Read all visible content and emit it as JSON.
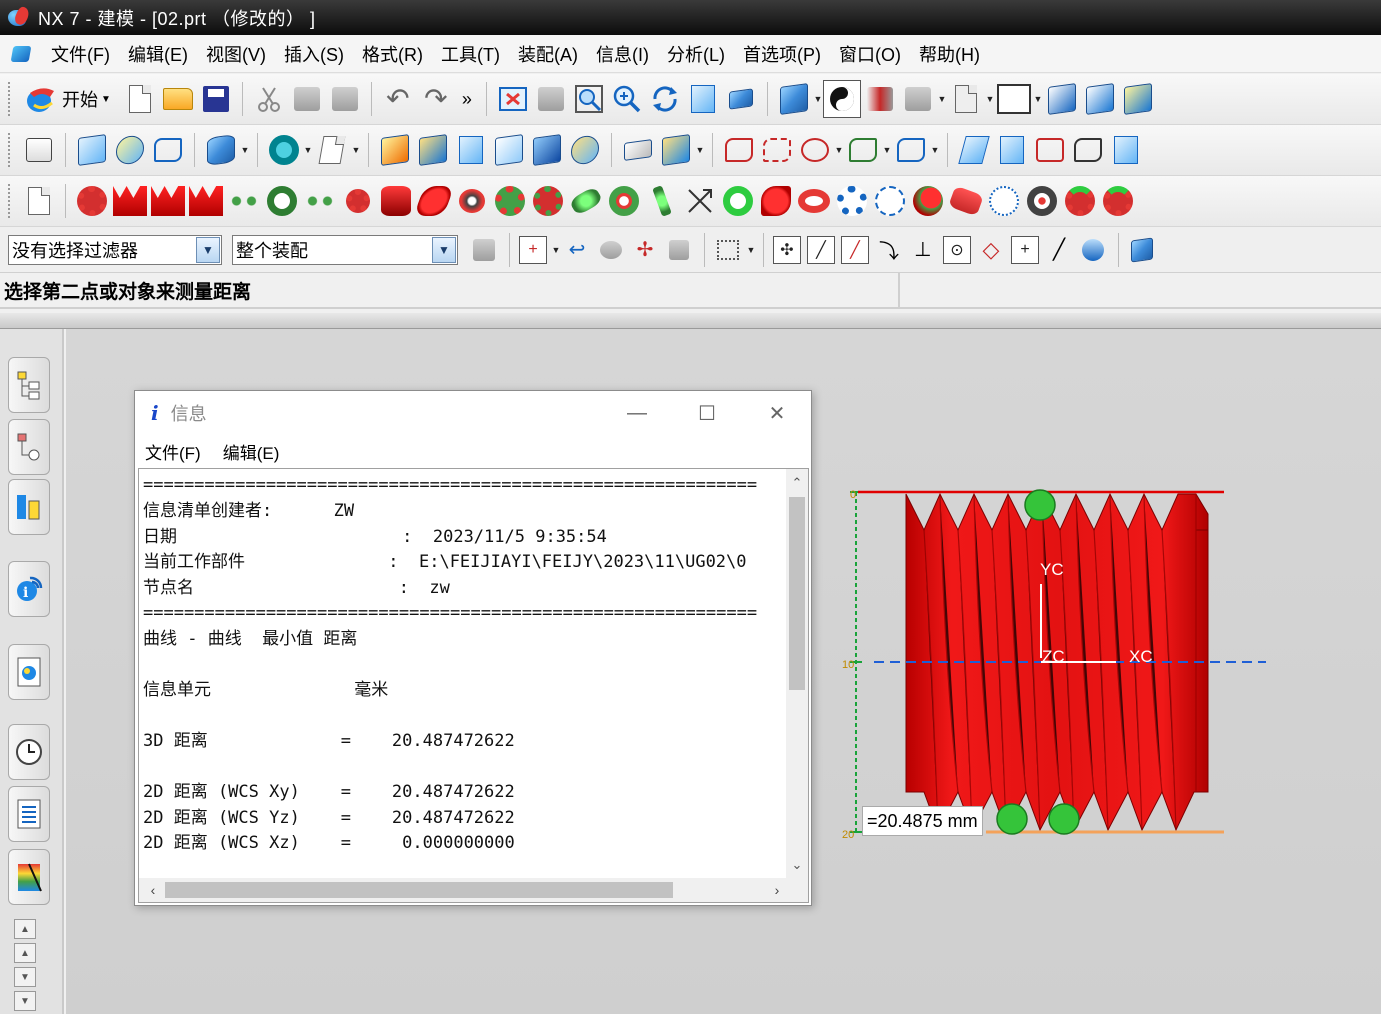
{
  "window": {
    "title": "NX 7 - 建模 - [02.prt （修改的） ]"
  },
  "menu": [
    "文件(F)",
    "编辑(E)",
    "视图(V)",
    "插入(S)",
    "格式(R)",
    "工具(T)",
    "装配(A)",
    "信息(I)",
    "分析(L)",
    "首选项(P)",
    "窗口(O)",
    "帮助(H)"
  ],
  "toolbar": {
    "start_label": "开始",
    "more_label": "»"
  },
  "filter": {
    "selection_filter": "没有选择过滤器",
    "assembly_scope": "整个装配"
  },
  "cue_line": "选择第二点或对象来测量距离",
  "info_dialog": {
    "title": "信息",
    "menu": [
      "文件(F)",
      "编辑(E)"
    ],
    "lines": [
      "============================================================",
      "信息清单创建者:      ZW",
      "日期                      :  2023/11/5 9:35:54",
      "当前工作部件              :  E:\\FEIJIAYI\\FEIJY\\2023\\11\\UG02\\0",
      "节点名                    :  zw",
      "============================================================",
      "曲线 - 曲线  最小值 距离",
      "",
      "信息单元              毫米",
      "",
      "3D 距离             =    20.487472622",
      "",
      "2D 距离 (WCS Xy)    =    20.487472622",
      "2D 距离 (WCS Yz)    =    20.487472622",
      "2D 距离 (WCS Xz)    =     0.000000000"
    ]
  },
  "viewport": {
    "measure_readout": "=20.4875 mm",
    "axis_yc": "YC",
    "axis_zc": "ZC",
    "axis_xc": "XC",
    "ruler_marks": [
      "0",
      "10",
      "20"
    ]
  },
  "colors": {
    "part_red": "#e31212",
    "dimension_green": "#19a33a",
    "axis_blue": "#1f5fd6",
    "graphics_bg": "#d3d3d3"
  }
}
